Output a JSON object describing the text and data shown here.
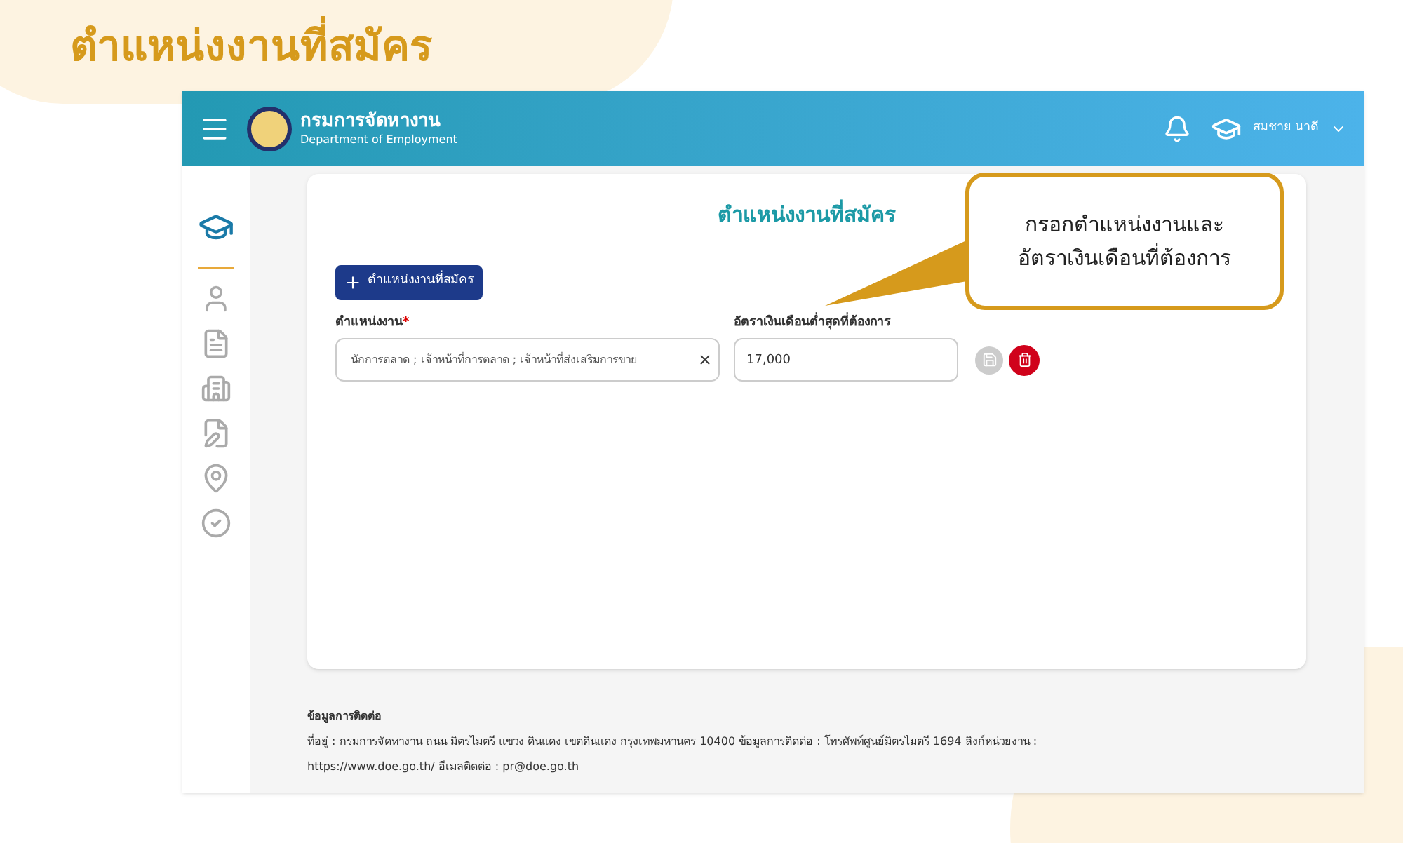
{
  "slide_title": "ตำแหน่งงานที่สมัคร",
  "header": {
    "org_name": "กรมการจัดหางาน",
    "org_subtitle": "Department of Employment",
    "user_name": "สมชาย นาดี"
  },
  "sidebar": {
    "items": [
      {
        "kind": "cap",
        "selected": true
      },
      {
        "kind": "user",
        "selected": false
      },
      {
        "kind": "file",
        "selected": false
      },
      {
        "kind": "building",
        "selected": false
      },
      {
        "kind": "edit",
        "selected": false
      },
      {
        "kind": "pin",
        "selected": false
      },
      {
        "kind": "check",
        "selected": false
      }
    ]
  },
  "card": {
    "title": "ตำแหน่งงานที่สมัคร",
    "add_button": "ตำแหน่งงานที่สมัคร",
    "position_label": "ตำแหน่งงาน",
    "position_required_mark": "*",
    "position_value": "นักการตลาด ; เจ้าหน้าที่การตลาด ; เจ้าหน้าที่ส่งเสริมการขาย",
    "salary_label": "อัตราเงินเดือนต่ำสุดที่ต้องการ",
    "salary_value": "17,000",
    "save_disabled": true
  },
  "callout": {
    "text_lines": [
      "กรอกตำแหน่งงานและ",
      "อัตราเงินเดือนที่ต้องการ"
    ]
  },
  "footer": {
    "heading": "ข้อมูลการติดต่อ",
    "address": "ที่อยู่ : กรมการจัดหางาน ถนน มิตรไมตรี แขวง ดินแดง เขตดินแดง กรุงเทพมหานคร 10400 ข้อมูลการติดต่อ : โทรศัพท์ศูนย์มิตรไมตรี 1694 ลิงก์หน่วยงาน :",
    "links": "https://www.doe.go.th/ อีเมลติดต่อ : pr@doe.go.th"
  }
}
